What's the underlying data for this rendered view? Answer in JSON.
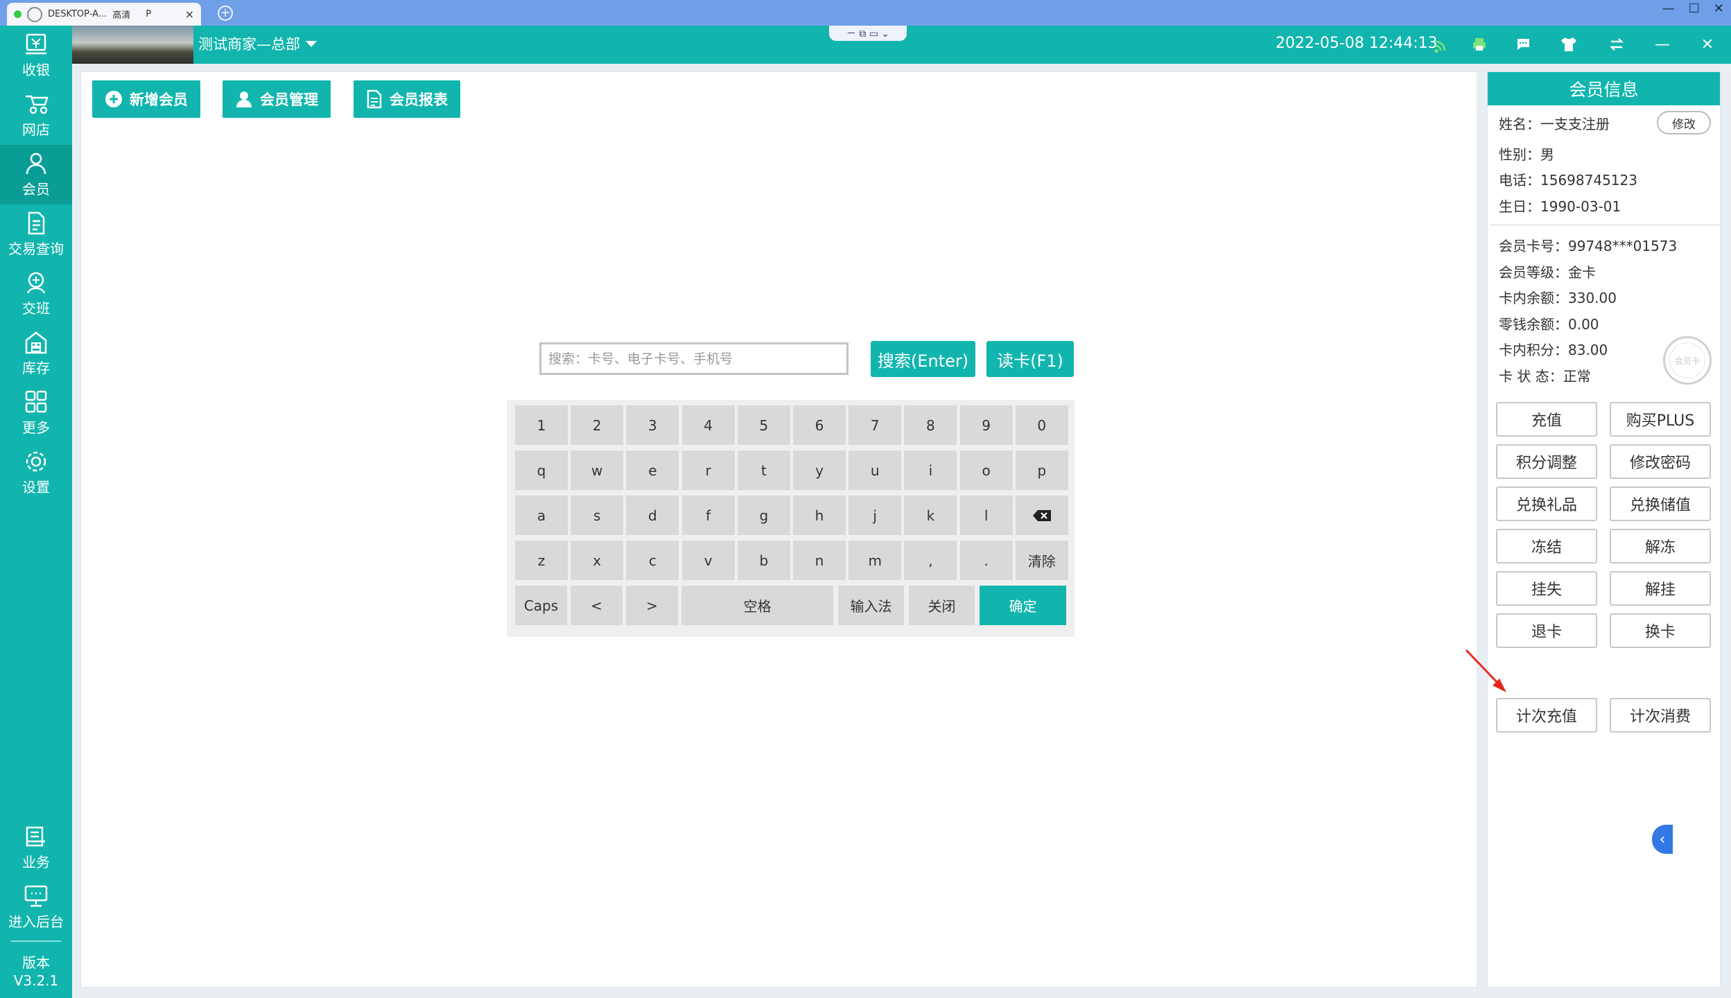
{
  "remote": {
    "tab_title": "DESKTOP-A...",
    "tab_quality": "高清",
    "tab_p": "P",
    "tab_close": "×",
    "add": "+",
    "mini_toolbar": "－ ⧉ ▭ ⌄",
    "window_controls": {
      "minimize": "—",
      "maximize": "☐",
      "close": "✕"
    }
  },
  "header": {
    "store_name": "测试商家—总部",
    "datetime": "2022-05-08 12:44:13",
    "icons": [
      "wifi-icon",
      "printer-icon",
      "message-icon",
      "shirt-icon",
      "switch-icon",
      "minimize-icon",
      "close-icon"
    ],
    "minimize": "—",
    "close": "✕"
  },
  "sidebar": {
    "items": [
      {
        "label": "收银",
        "icon": "cash-register-icon"
      },
      {
        "label": "网店",
        "icon": "online-store-icon"
      },
      {
        "label": "会员",
        "icon": "member-icon"
      },
      {
        "label": "交易查询",
        "icon": "transaction-query-icon"
      },
      {
        "label": "交班",
        "icon": "shift-change-icon"
      },
      {
        "label": "库存",
        "icon": "inventory-icon"
      },
      {
        "label": "更多",
        "icon": "more-icon"
      },
      {
        "label": "设置",
        "icon": "settings-icon"
      }
    ],
    "bottom_items": [
      {
        "label": "业务",
        "icon": "business-icon"
      },
      {
        "label": "进入后台",
        "icon": "backend-icon"
      }
    ],
    "version_label": "版本",
    "version": "V3.2.1"
  },
  "toolbar": {
    "add_member": "新增会员",
    "member_manage": "会员管理",
    "member_report": "会员报表"
  },
  "search": {
    "placeholder": "搜索：卡号、电子卡号、手机号",
    "search_button": "搜索(Enter)",
    "read_card_button": "读卡(F1)"
  },
  "keyboard": {
    "row1": [
      "1",
      "2",
      "3",
      "4",
      "5",
      "6",
      "7",
      "8",
      "9",
      "0"
    ],
    "row2": [
      "q",
      "w",
      "e",
      "r",
      "t",
      "y",
      "u",
      "i",
      "o",
      "p"
    ],
    "row3": [
      "a",
      "s",
      "d",
      "f",
      "g",
      "h",
      "j",
      "k",
      "l"
    ],
    "row4": [
      "z",
      "x",
      "c",
      "v",
      "b",
      "n",
      "m",
      ",",
      "."
    ],
    "clear": "清除",
    "caps": "Caps",
    "left": "<",
    "right": ">",
    "space": "空格",
    "ime": "输入法",
    "close": "关闭",
    "confirm": "确定"
  },
  "member": {
    "title": "会员信息",
    "edit": "修改",
    "name": "姓名：一支支注册",
    "gender": "性别：男",
    "phone": "电话：15698745123",
    "birthday": "生日：1990-03-01",
    "card_no": "会员卡号：99748***01573",
    "level": "会员等级：金卡",
    "balance": "卡内余额：330.00",
    "change_balance": "零钱余额：0.00",
    "points": "卡内积分：83.00",
    "card_status": "卡 状 态：正常",
    "stamp_text": "会员卡",
    "actions": [
      "充值",
      "购买PLUS",
      "积分调整",
      "修改密码",
      "兑换礼品",
      "兑换储值",
      "冻结",
      "解冻",
      "挂失",
      "解挂",
      "退卡",
      "换卡"
    ],
    "count_recharge": "计次充值",
    "count_consume": "计次消费"
  },
  "colors": {
    "teal": "#11b5ad",
    "teal_dark": "#0a9d96",
    "blue_tab": "#6f9fe6",
    "arrow_red": "#e8281e",
    "collapse_blue": "#3478e6"
  }
}
